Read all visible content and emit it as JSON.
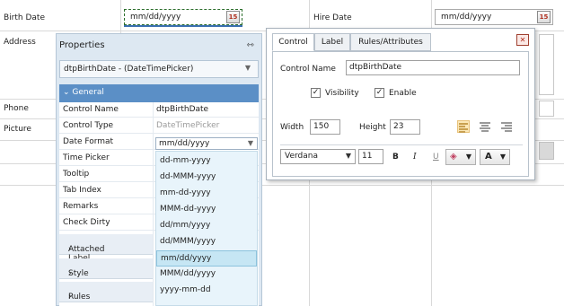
{
  "form": {
    "birth_date_label": "Birth Date",
    "birth_date_value": "mm/dd/yyyy",
    "hire_date_label": "Hire Date",
    "hire_date_value": "mm/dd/yyyy",
    "address_label": "Address",
    "phone_label": "Phone",
    "picture_label": "Picture",
    "calendar_icon_text": "15"
  },
  "properties": {
    "title": "Properties",
    "selected_control": "dtpBirthDate - (DateTimePicker)",
    "group_label": "General",
    "rows": [
      {
        "name": "Control Name",
        "value": "dtpBirthDate"
      },
      {
        "name": "Control Type",
        "value": "DateTimePicker"
      },
      {
        "name": "Date Format",
        "value": ""
      },
      {
        "name": "Time Picker",
        "value": ""
      },
      {
        "name": "Tooltip",
        "value": ""
      },
      {
        "name": "Tab Index",
        "value": ""
      },
      {
        "name": "Remarks",
        "value": ""
      },
      {
        "name": "Check Dirty",
        "value": ""
      }
    ],
    "sections": [
      "Attached Label",
      "Style",
      "Rules"
    ],
    "date_format_value": "mm/dd/yyyy",
    "date_format_options": [
      "dd-mm-yyyy",
      "dd-MMM-yyyy",
      "mm-dd-yyyy",
      "MMM-dd-yyyy",
      "dd/mm/yyyy",
      "dd/MMM/yyyy",
      "mm/dd/yyyy",
      "MMM/dd/yyyy",
      "yyyy-mm-dd"
    ],
    "date_format_selected_index": 6
  },
  "dialog": {
    "tabs": [
      "Control",
      "Label",
      "Rules/Attributes"
    ],
    "active_tab": "Control",
    "control_name_label": "Control Name",
    "control_name_value": "dtpBirthDate",
    "visibility_label": "Visibility",
    "enable_label": "Enable",
    "width_label": "Width",
    "width_value": "150",
    "height_label": "Height",
    "height_value": "23",
    "font_family": "Verdana",
    "font_size": "11",
    "bold": "B",
    "italic": "I",
    "underline": "U",
    "font_color_glyph": "A",
    "close_glyph": "✕"
  },
  "colors": {
    "panel_bg": "#dde8f2",
    "group_header": "#5b8fc6",
    "dropdown_highlight": "#c6e6f4",
    "align_active": "#fbe7b6",
    "close_red": "#b02a1a"
  }
}
